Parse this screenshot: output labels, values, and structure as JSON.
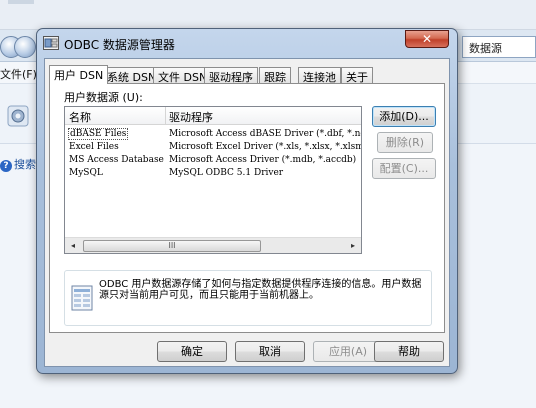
{
  "background": {
    "menu_file": "文件(F)",
    "search_text": "数据源",
    "help_text": "搜索"
  },
  "dialog": {
    "title": "ODBC 数据源管理器",
    "close_glyph": "✕",
    "tabs": [
      "用户 DSN",
      "系统 DSN",
      "文件 DSN",
      "驱动程序",
      "跟踪",
      "连接池",
      "关于"
    ],
    "panel_label": "用户数据源 (U):",
    "list": {
      "headers": [
        "名称",
        "驱动程序"
      ],
      "rows": [
        {
          "name": "dBASE Files",
          "driver": "Microsoft Access dBASE Driver (*.dbf, *.ndx"
        },
        {
          "name": "Excel Files",
          "driver": "Microsoft Excel Driver (*.xls, *.xlsx, *.xlsm"
        },
        {
          "name": "MS Access Database",
          "driver": "Microsoft Access Driver (*.mdb, *.accdb)"
        },
        {
          "name": "MySQL",
          "driver": "MySQL ODBC 5.1 Driver"
        }
      ],
      "scroll_left": "◂",
      "scroll_right": "▸",
      "scroll_thumb": "III"
    },
    "buttons": {
      "add": "添加(D)...",
      "remove": "删除(R)",
      "configure": "配置(C)..."
    },
    "info_text": "ODBC 用户数据源存储了如何与指定数据提供程序连接的信息。用户数据源只对当前用户可见，而且只能用于当前机器上。",
    "bottom_buttons": {
      "ok": "确定",
      "cancel": "取消",
      "apply": "应用(A)",
      "help": "帮助"
    }
  }
}
